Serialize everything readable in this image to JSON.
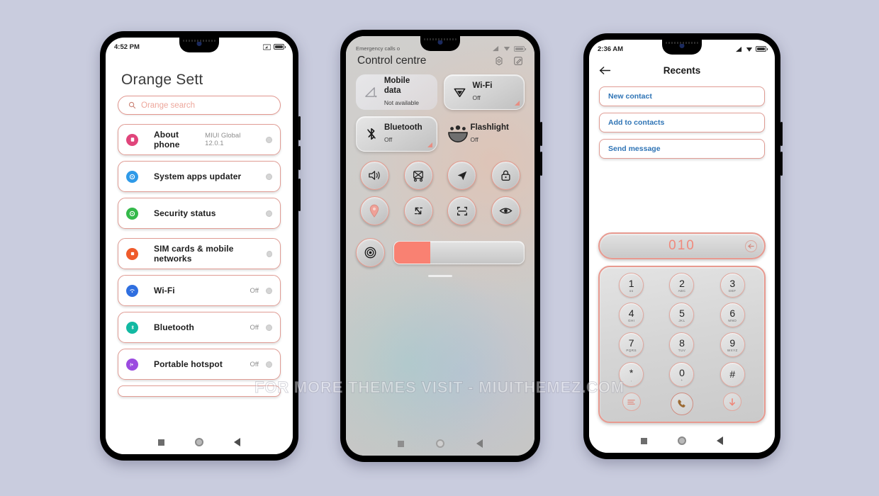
{
  "background_color": "#c9ccde",
  "accent_color": "#e09c94",
  "salmon_color": "#f98172",
  "watermark": "FOR MORE THEMES VISIT - MIUITHEMEZ.COM",
  "settings_phone": {
    "statusbar": {
      "time": "4:52 PM",
      "signal_icon": "signal-icon",
      "battery_icon": "battery-icon"
    },
    "title": "Orange Sett",
    "search": {
      "placeholder": "Orange search",
      "icon": "search-icon"
    },
    "groups": [
      {
        "rows": [
          {
            "label": "About phone",
            "value": "MIUI Global 12.0.1",
            "icon": "about-phone-icon",
            "color": "#e0457b"
          },
          {
            "label": "System apps updater",
            "value": "",
            "icon": "system-updater-icon",
            "color": "#2f9ae8"
          },
          {
            "label": "Security status",
            "value": "",
            "icon": "security-status-icon",
            "color": "#34b94a"
          }
        ]
      },
      {
        "rows": [
          {
            "label": "SIM cards & mobile networks",
            "value": "",
            "icon": "sim-card-icon",
            "color": "#ef5b2b"
          },
          {
            "label": "Wi-Fi",
            "value": "Off",
            "icon": "wifi-icon",
            "color": "#2f6fe0"
          },
          {
            "label": "Bluetooth",
            "value": "Off",
            "icon": "bluetooth-icon",
            "color": "#12b9a2"
          },
          {
            "label": "Portable hotspot",
            "value": "Off",
            "icon": "hotspot-icon",
            "color": "#9b4be0"
          }
        ]
      }
    ],
    "navbar": {
      "recents": "recents-icon",
      "home": "home-icon",
      "back": "back-icon"
    }
  },
  "control_centre": {
    "statusbar": {
      "carrier": "Emergency calls o",
      "signal_icon": "signal-icon",
      "wifi_icon": "wifi-icon",
      "battery_icon": "battery-icon"
    },
    "title": "Control centre",
    "header_actions": [
      {
        "name": "settings-gear-icon"
      },
      {
        "name": "edit-icon"
      }
    ],
    "tiles": [
      {
        "name": "Mobile data",
        "sub": "Not available",
        "icon": "mobile-data-icon",
        "state": "dim"
      },
      {
        "name": "Wi-Fi",
        "sub": "Off",
        "icon": "wifi-icon",
        "state": "lit"
      },
      {
        "name": "Bluetooth",
        "sub": "Off",
        "icon": "bluetooth-icon",
        "state": "lit"
      },
      {
        "name": "Flashlight",
        "sub": "Off",
        "icon": "flashlight-icon",
        "state": "plain"
      }
    ],
    "toggles": [
      {
        "icon": "sound-icon"
      },
      {
        "icon": "screenshot-icon"
      },
      {
        "icon": "airplane-icon"
      },
      {
        "icon": "lock-icon"
      },
      {
        "icon": "location-icon"
      },
      {
        "icon": "auto-rotate-icon"
      },
      {
        "icon": "scan-icon"
      },
      {
        "icon": "reading-mode-icon"
      }
    ],
    "brightness": {
      "icon": "brightness-icon",
      "percent": 28
    },
    "navbar": {
      "recents": "recents-icon",
      "home": "home-icon",
      "back": "back-icon"
    }
  },
  "dialer_phone": {
    "statusbar": {
      "time": "2:36 AM",
      "signal_icon": "signal-icon",
      "wifi_icon": "wifi-icon",
      "battery_icon": "battery-icon"
    },
    "header": {
      "back_icon": "back-arrow-icon",
      "title": "Recents"
    },
    "actions": [
      {
        "label": "New contact"
      },
      {
        "label": "Add to contacts"
      },
      {
        "label": "Send message"
      }
    ],
    "number_display": {
      "value": "010",
      "delete_icon": "backspace-icon"
    },
    "keys": [
      {
        "digit": "1",
        "letters": "oo"
      },
      {
        "digit": "2",
        "letters": "ABC"
      },
      {
        "digit": "3",
        "letters": "DEF"
      },
      {
        "digit": "4",
        "letters": "GHI"
      },
      {
        "digit": "5",
        "letters": "JKL"
      },
      {
        "digit": "6",
        "letters": "MNO"
      },
      {
        "digit": "7",
        "letters": "PQRS"
      },
      {
        "digit": "8",
        "letters": "TUV"
      },
      {
        "digit": "9",
        "letters": "WXYZ"
      },
      {
        "digit": "*",
        "letters": ","
      },
      {
        "digit": "0",
        "letters": "+"
      },
      {
        "digit": "#",
        "letters": ""
      }
    ],
    "bottom_actions": [
      {
        "icon": "menu-icon"
      },
      {
        "icon": "call-icon"
      },
      {
        "icon": "hide-dialpad-icon"
      }
    ],
    "navbar": {
      "recents": "recents-icon",
      "home": "home-icon",
      "back": "back-icon"
    }
  }
}
